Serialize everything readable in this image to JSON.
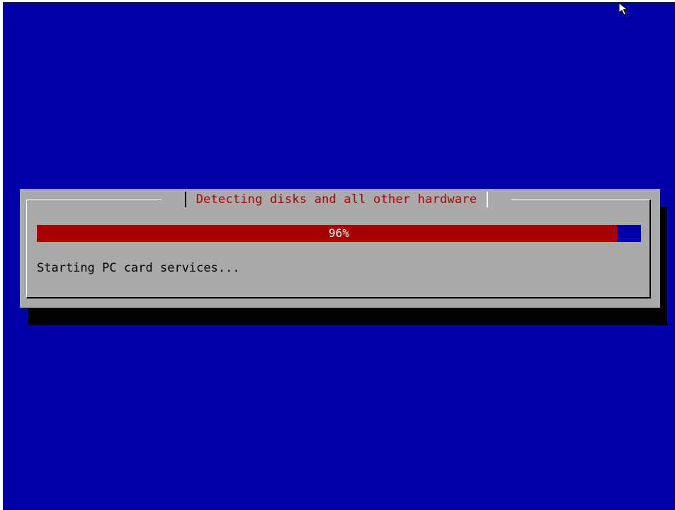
{
  "colors": {
    "background": "#0000a8",
    "dialog": "#aaaaaa",
    "title": "#a80000",
    "progress_fill": "#a80000",
    "progress_track": "#0000a8"
  },
  "dialog": {
    "title": "Detecting disks and all other hardware",
    "progress": {
      "percent": 96,
      "label": "96%"
    },
    "status": "Starting PC card services..."
  },
  "cursor": {
    "icon": "mouse-pointer-icon"
  }
}
